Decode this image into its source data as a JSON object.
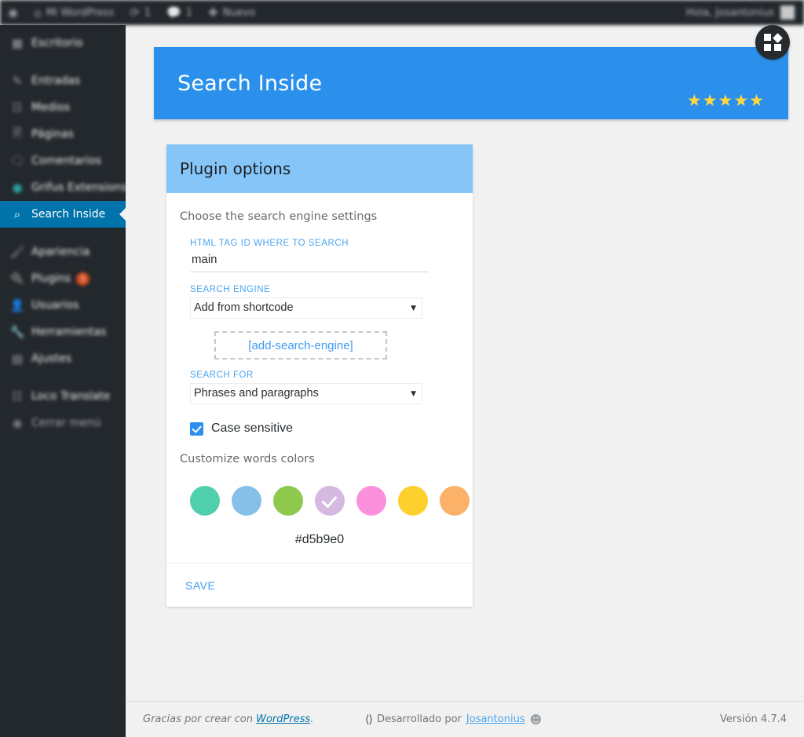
{
  "adminbar": {
    "logo_icon": "wordpress-logo-icon",
    "site_icon": "home-icon",
    "site_name": "Mi WordPress",
    "updates_icon": "updates-icon",
    "updates_count": "1",
    "comments_icon": "comment-bubble-icon",
    "comments_count": "1",
    "new_icon": "plus-icon",
    "new_label": "Nuevo",
    "greeting": "Hola, Josantonius",
    "avatar_icon": "avatar"
  },
  "sidebar": {
    "items": [
      {
        "label": "Escritorio",
        "icon": "dashboard-icon",
        "state": "normal"
      },
      {
        "label": "Entradas",
        "icon": "pin-icon",
        "state": "normal"
      },
      {
        "label": "Medios",
        "icon": "media-icon",
        "state": "normal"
      },
      {
        "label": "Páginas",
        "icon": "page-icon",
        "state": "normal"
      },
      {
        "label": "Comentarios",
        "icon": "comment-icon",
        "state": "normal"
      },
      {
        "label": "Grifus Extensions",
        "icon": "circle-teal-icon",
        "state": "teal"
      },
      {
        "label": "Search Inside",
        "icon": "search-plus-icon",
        "state": "active"
      },
      {
        "label": "Apariencia",
        "icon": "brush-icon",
        "state": "normal"
      },
      {
        "label": "Plugins",
        "icon": "plug-icon",
        "state": "normal",
        "badge": "1"
      },
      {
        "label": "Usuarios",
        "icon": "users-icon",
        "state": "normal"
      },
      {
        "label": "Herramientas",
        "icon": "tools-icon",
        "state": "normal"
      },
      {
        "label": "Ajustes",
        "icon": "settings-icon",
        "state": "normal"
      },
      {
        "label": "Loco Translate",
        "icon": "translate-icon",
        "state": "normal"
      },
      {
        "label": "Cerrar menú",
        "icon": "collapse-icon",
        "state": "dim"
      }
    ]
  },
  "banner": {
    "title": "Search Inside",
    "stars": "★★★★★",
    "star_count": 5,
    "badge_icon": "plugin-grid-badge-icon",
    "bg_color": "#2b90ec",
    "star_color": "#ffd83b"
  },
  "card": {
    "header_title": "Plugin options",
    "header_color": "#86c5f8",
    "section_title": "Choose the search engine settings",
    "fields": {
      "html_tag": {
        "label": "HTML TAG ID WHERE TO SEARCH",
        "value": "main",
        "placeholder": "main"
      },
      "search_engine": {
        "label": "SEARCH ENGINE",
        "value": "Add from shortcode",
        "caret": "▼"
      },
      "shortcode": {
        "text": "[add-search-engine]"
      },
      "search_for": {
        "label": "SEARCH FOR",
        "value": "Phrases and paragraphs",
        "caret": "▼"
      },
      "case_sensitive": {
        "label": "Case sensitive",
        "checked": true
      }
    },
    "colors_title": "Customize words colors",
    "swatches": [
      {
        "name": "teal",
        "hex": "#50cfad",
        "selected": false
      },
      {
        "name": "blue",
        "hex": "#86c0e8",
        "selected": false
      },
      {
        "name": "green",
        "hex": "#8ec94e",
        "selected": false
      },
      {
        "name": "purple",
        "hex": "#d5b9e0",
        "selected": true
      },
      {
        "name": "pink",
        "hex": "#fd90dd",
        "selected": false
      },
      {
        "name": "yellow",
        "hex": "#fcd12e",
        "selected": false
      },
      {
        "name": "orange",
        "hex": "#fbb268",
        "selected": false
      }
    ],
    "hex_value": "#d5b9e0",
    "save_label": "SAVE"
  },
  "footer": {
    "thanks_prefix": "Gracias por crear con ",
    "wordpress_link": "WordPress",
    "thanks_suffix": ".",
    "code_icon": "code-brackets-icon",
    "developed_by": "Desarrollado por",
    "author": "Josantonius",
    "fingerprint_icon": "fingerprint-icon",
    "version": "Versión 4.7.4"
  }
}
